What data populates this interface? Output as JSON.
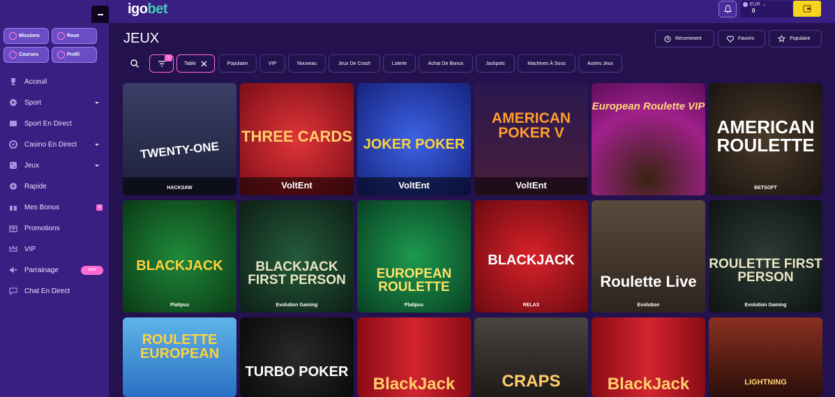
{
  "header": {
    "logo_main": "igo",
    "logo_accent": "bet",
    "currency": "EUR",
    "balance": "0"
  },
  "sidebar": {
    "quick": [
      "Missions",
      "Roue",
      "Courses",
      "Profil"
    ],
    "items": [
      {
        "label": "Acceuil",
        "icon": "trophy-icon"
      },
      {
        "label": "Sport",
        "icon": "ball-icon"
      },
      {
        "label": "Sport En Direct",
        "icon": "live-sport-icon"
      },
      {
        "label": "Casino En Direct",
        "icon": "casino-chip-icon"
      },
      {
        "label": "Jeux",
        "icon": "dice-icon"
      },
      {
        "label": "Rapide",
        "icon": "bolt-icon"
      },
      {
        "label": "Mes Bonus",
        "icon": "gift-icon",
        "badge": "3"
      },
      {
        "label": "Promotions",
        "icon": "present-icon"
      },
      {
        "label": "VIP",
        "icon": "crown-icon"
      },
      {
        "label": "Parrainage",
        "icon": "megaphone-icon",
        "tag": "NEW"
      },
      {
        "label": "Chat En Direct",
        "icon": "chat-icon"
      }
    ]
  },
  "main": {
    "title": "JEUX",
    "sort": [
      "Récemment",
      "Favoris",
      "Populaire"
    ],
    "filter_count": "1",
    "chips": [
      "Table",
      "Populaire",
      "VIP",
      "Nouveau",
      "Jeux De Crash",
      "Loterie",
      "Achat De Bonus",
      "Jackpots",
      "Machines À Sous",
      "Autres Jeux"
    ],
    "games": [
      {
        "title": "TWENTY-ONE",
        "provider": "HACKSAW"
      },
      {
        "title": "THREE CARDS",
        "provider": "VoltEnt"
      },
      {
        "title": "JOKER POKER",
        "provider": "VoltEnt"
      },
      {
        "title": "AMERICAN POKER V",
        "provider": "VoltEnt"
      },
      {
        "title": "European Roulette VIP",
        "provider": ""
      },
      {
        "title": "AMERICAN ROULETTE",
        "provider": "BETSOFT"
      },
      {
        "title": "BLACKJACK",
        "provider": "Platipus"
      },
      {
        "title": "BLACKJACK FIRST PERSON",
        "provider": "Evolution Gaming"
      },
      {
        "title": "EUROPEAN ROULETTE",
        "provider": "Platipus"
      },
      {
        "title": "BLACKJACK",
        "provider": "RELAX"
      },
      {
        "title": "Roulette Live",
        "provider": "Evolution"
      },
      {
        "title": "ROULETTE FIRST PERSON",
        "provider": "Evolution Gaming"
      },
      {
        "title": "ROULETTE EUROPEAN",
        "provider": ""
      },
      {
        "title": "TURBO POKER",
        "provider": ""
      },
      {
        "title": "BlackJack",
        "provider": ""
      },
      {
        "title": "CRAPS",
        "provider": ""
      },
      {
        "title": "BlackJack",
        "provider": ""
      },
      {
        "title": "LIGHTNING",
        "provider": ""
      }
    ]
  },
  "colors": {
    "accent": "#ff6ad5",
    "sidebar": "#3a1f83",
    "background": "#24124f",
    "wallet": "#f7d51f"
  }
}
